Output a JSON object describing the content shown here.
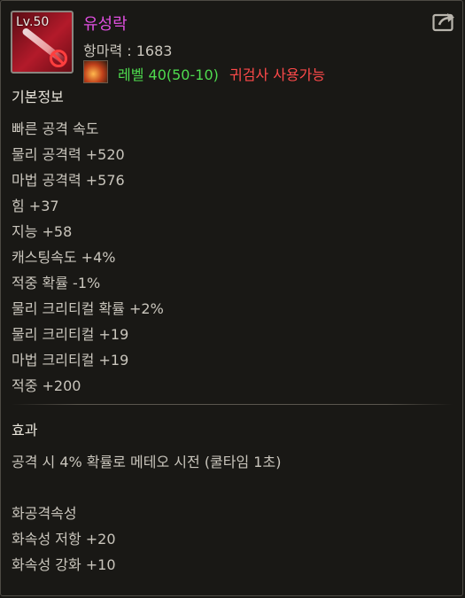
{
  "item": {
    "level_badge": "Lv.50",
    "name": "유성락",
    "combat_power": "항마력 : 1683",
    "requirement_level": "레벨 40(50-10)",
    "requirement_class": "귀검사 사용가능"
  },
  "sections": {
    "basic_title": "기본정보",
    "basic_stats": [
      "빠른 공격 속도",
      "물리 공격력 +520",
      "마법 공격력 +576",
      "힘 +37",
      "지능 +58",
      "캐스팅속도 +4%",
      "적중 확률 -1%",
      "물리 크리티컬 확률 +2%",
      "물리 크리티컬 +19",
      "마법 크리티컬 +19",
      "적중 +200"
    ],
    "effect_title": "효과",
    "effect_lines": [
      "공격 시 4% 확률로 메테오 시전 (쿨타임 1초)",
      "",
      "화공격속성",
      "화속성 저항 +20",
      "화속성 강화 +10"
    ]
  },
  "colors": {
    "name": "#e04fe0",
    "requirement_ok": "#4fdc4f",
    "requirement_class": "#ff4a4a",
    "stat_text": "#c9c5bc"
  },
  "icons": [
    "item-sword-icon",
    "unusable-icon",
    "class-icon",
    "share-icon"
  ]
}
